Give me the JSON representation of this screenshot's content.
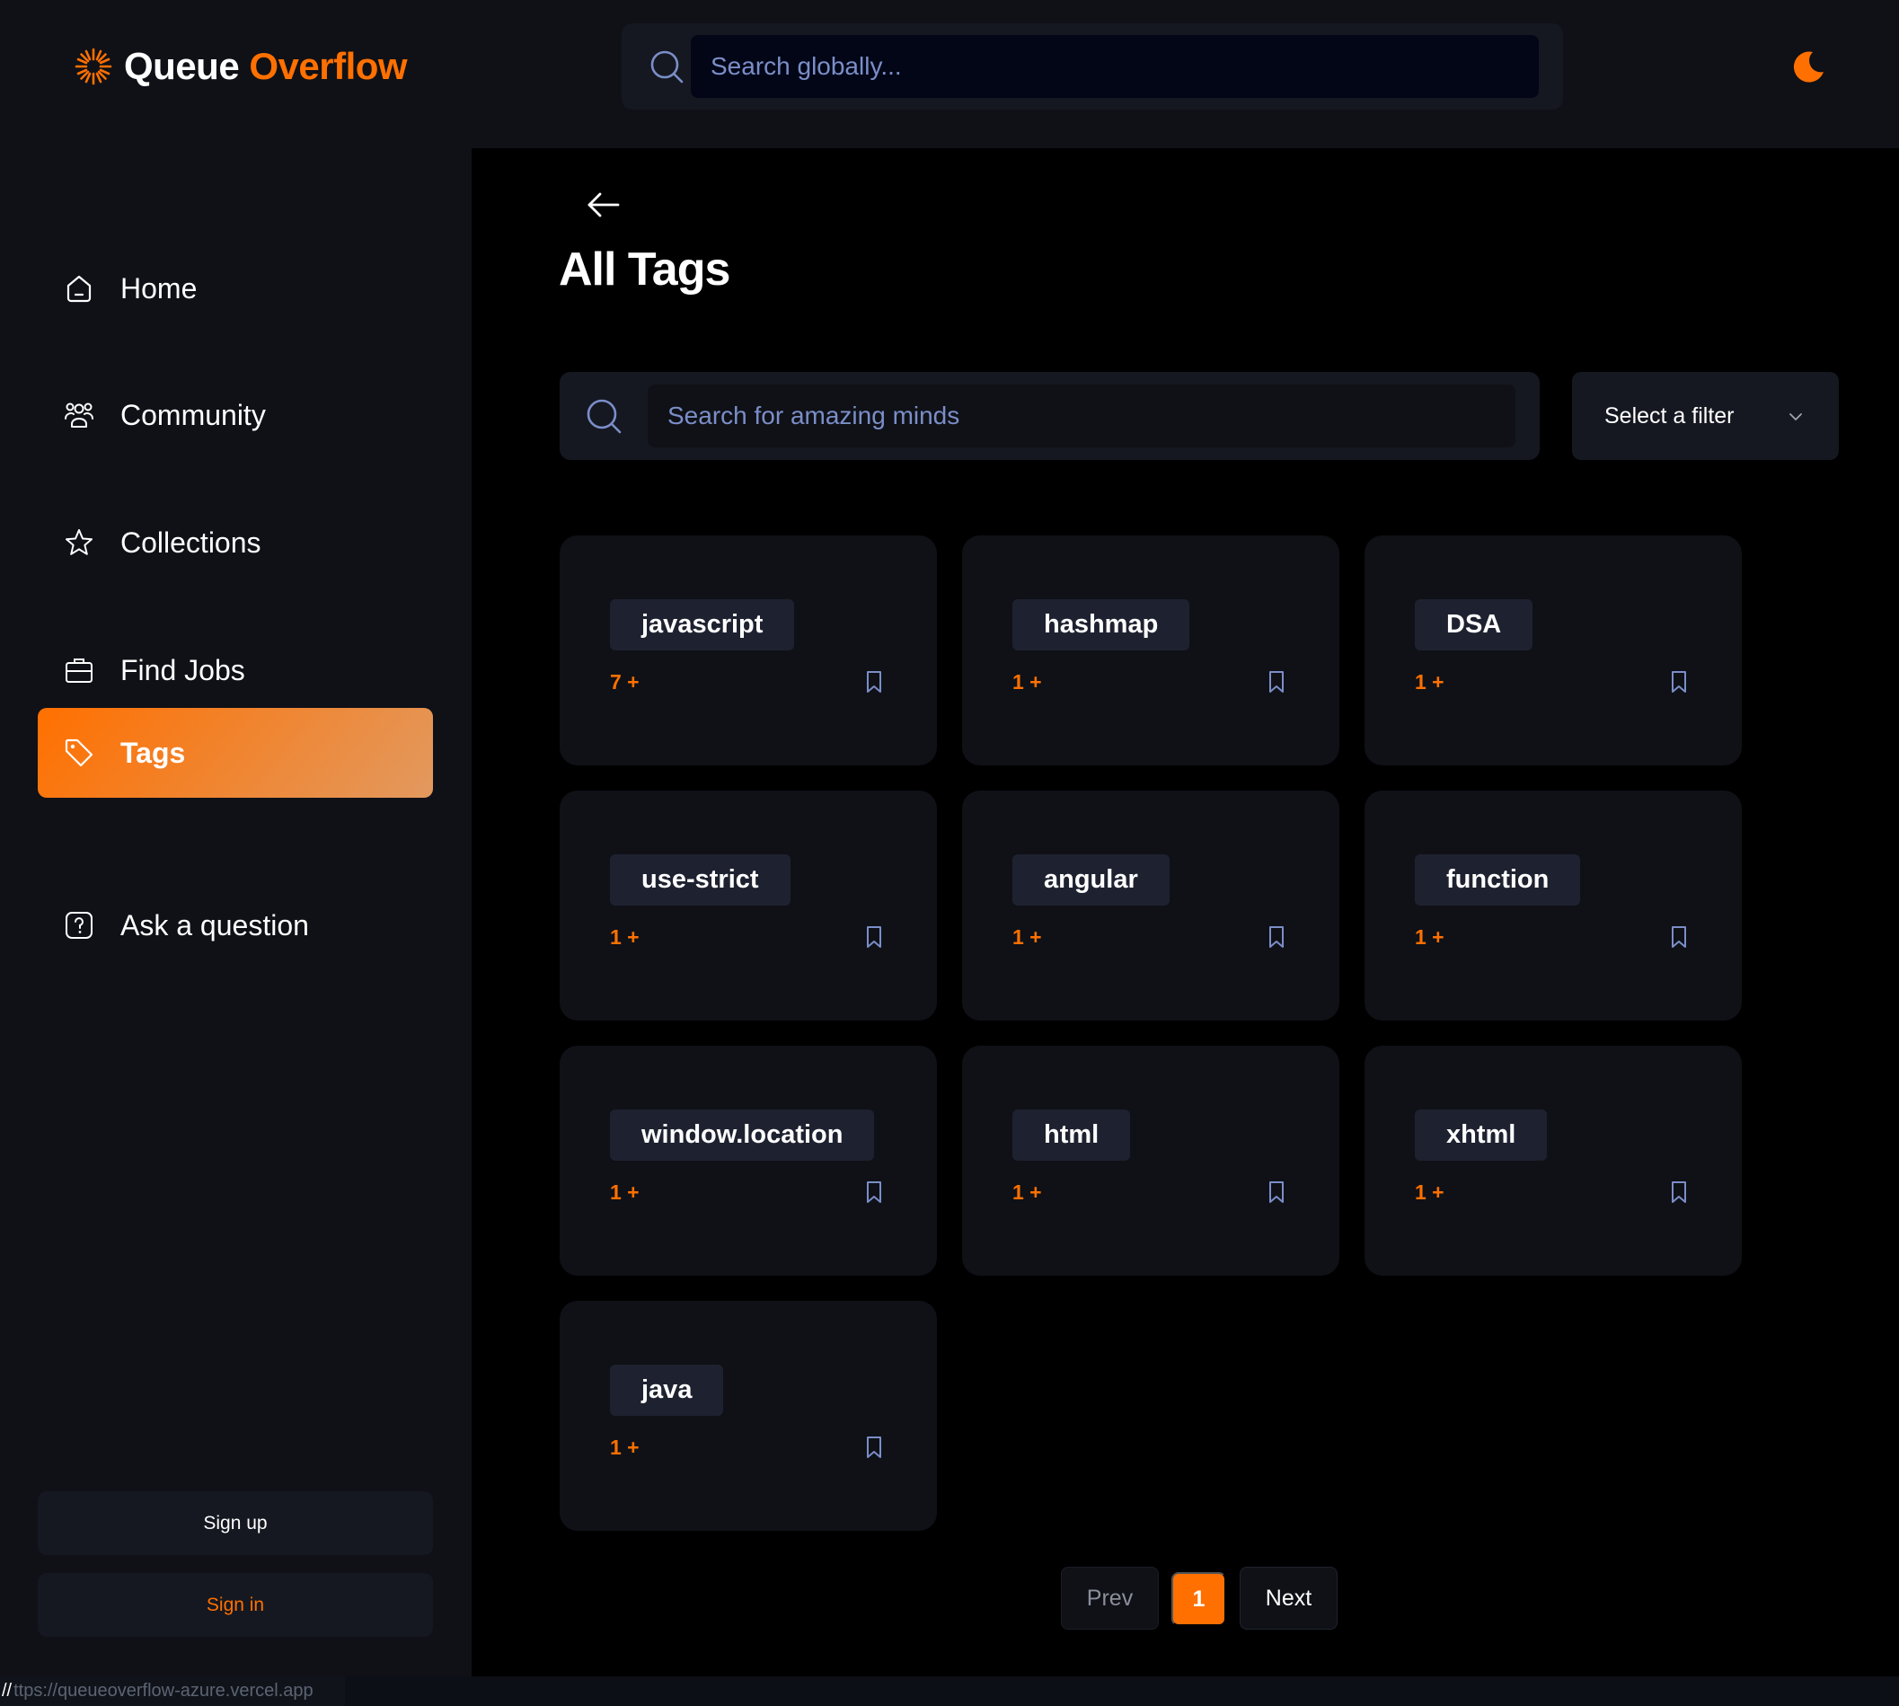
{
  "brand": {
    "name_part1": "Queue ",
    "name_part2": "Overflow",
    "accent": "#ff7000",
    "logo_icon": "sunburst-logo"
  },
  "header": {
    "search_placeholder": "Search globally...",
    "search_icon": "search-icon",
    "theme_icon": "moon-icon"
  },
  "sidebar": {
    "items": [
      {
        "label": "Home",
        "icon": "home-icon",
        "active": false
      },
      {
        "label": "Community",
        "icon": "users-icon",
        "active": false
      },
      {
        "label": "Collections",
        "icon": "star-icon",
        "active": false
      },
      {
        "label": "Find Jobs",
        "icon": "briefcase-icon",
        "active": false
      },
      {
        "label": "Tags",
        "icon": "tag-icon",
        "active": true
      },
      {
        "label": "Ask a question",
        "icon": "question-icon",
        "active": false
      }
    ],
    "signup_label": "Sign up",
    "signin_label": "Sign in"
  },
  "page": {
    "title": "All Tags",
    "search_placeholder": "Search for amazing minds",
    "filter_label": "Select a filter"
  },
  "tags": [
    {
      "name": "javascript",
      "count": "7 +"
    },
    {
      "name": "hashmap",
      "count": "1 +"
    },
    {
      "name": "DSA",
      "count": "1 +"
    },
    {
      "name": "use-strict",
      "count": "1 +"
    },
    {
      "name": "angular",
      "count": "1 +"
    },
    {
      "name": "function",
      "count": "1 +"
    },
    {
      "name": "window.location",
      "count": "1 +"
    },
    {
      "name": "html",
      "count": "1 +"
    },
    {
      "name": "xhtml",
      "count": "1 +"
    },
    {
      "name": "java",
      "count": "1 +"
    }
  ],
  "pagination": {
    "prev_label": "Prev",
    "current_page": "1",
    "next_label": "Next"
  },
  "status_bar": {
    "prefix": "//",
    "url": "ttps://queueoverflow-azure.vercel.app"
  }
}
